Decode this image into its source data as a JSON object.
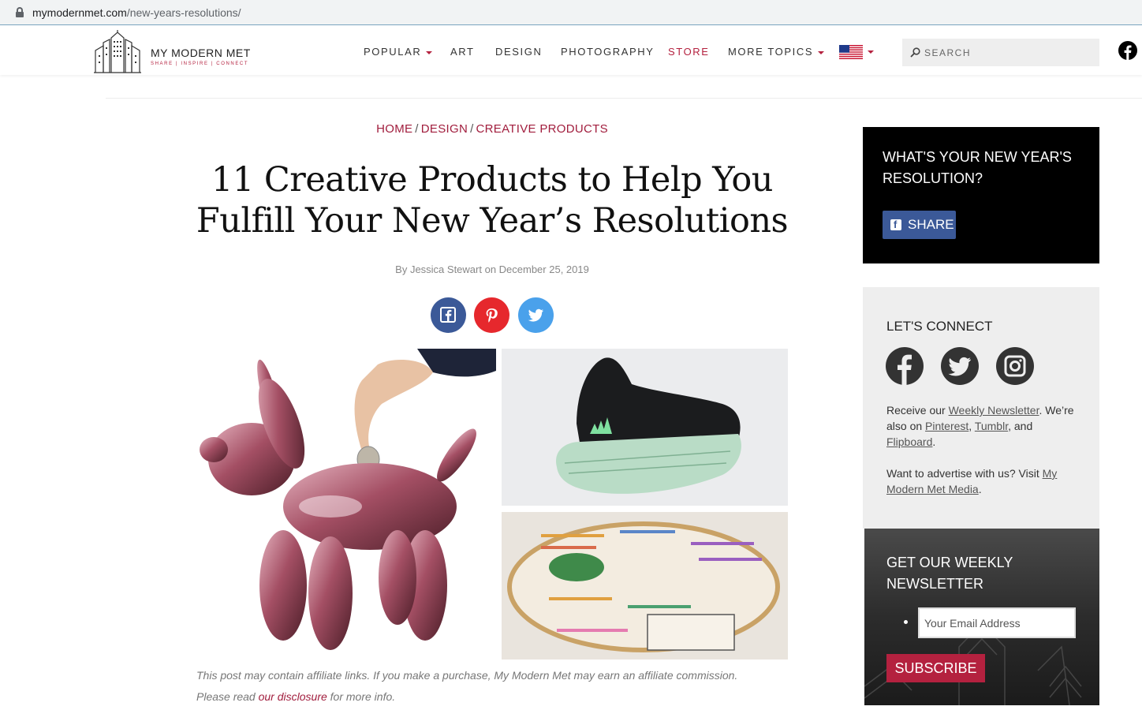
{
  "browser": {
    "url_host": "mymodernmet.com",
    "url_path": "/new-years-resolutions/"
  },
  "header": {
    "logo_name": "MY MODERN MET",
    "logo_tagline": "SHARE | INSPIRE | CONNECT",
    "nav": {
      "popular": "POPULAR",
      "art": "ART",
      "design": "DESIGN",
      "photography": "PHOTOGRAPHY",
      "store": "STORE",
      "more_topics": "MORE TOPICS"
    },
    "search_placeholder": "SEARCH"
  },
  "article": {
    "breadcrumb": {
      "home": "HOME",
      "design": "DESIGN",
      "creative_products": "CREATIVE PRODUCTS",
      "separator": "/"
    },
    "title_line1": "11 Creative Products to Help You",
    "title_line2": "Fulfill Your New Year’s Resolutions",
    "byline": "By Jessica Stewart on December 25, 2019",
    "disclaimer_line1": "This post may contain affiliate links. If you make a purchase, My Modern Met may earn an affiliate commission.",
    "disclaimer_prefix": "Please read ",
    "disclaimer_link": "our disclosure",
    "disclaimer_suffix": " for more info."
  },
  "sidebar": {
    "poll_question": "WHAT'S YOUR NEW YEAR'S RESOLUTION?",
    "poll_share": "SHARE",
    "connect_heading": "LET'S CONNECT",
    "connect_receive": "Receive our ",
    "connect_newsletter_link": "Weekly Newsletter",
    "connect_also": ". We’re also on ",
    "connect_pinterest": "Pinterest",
    "connect_comma": ", ",
    "connect_tumblr": "Tumblr",
    "connect_and": ", and ",
    "connect_flipboard": "Flipboard",
    "connect_period": ".",
    "advertise_text": "Want to advertise with us? Visit ",
    "advertise_link": "My Modern Met Media",
    "advertise_end": ".",
    "newsletter_heading": "GET OUR WEEKLY NEWSLETTER",
    "email_placeholder": "Your Email Address",
    "subscribe": "SUBSCRIBE"
  },
  "colors": {
    "brand_red": "#b4213f",
    "link_red": "#a11d3d",
    "facebook_blue": "#3b5998",
    "pinterest_red": "#e6282d",
    "twitter_blue": "#4aa1eb"
  }
}
